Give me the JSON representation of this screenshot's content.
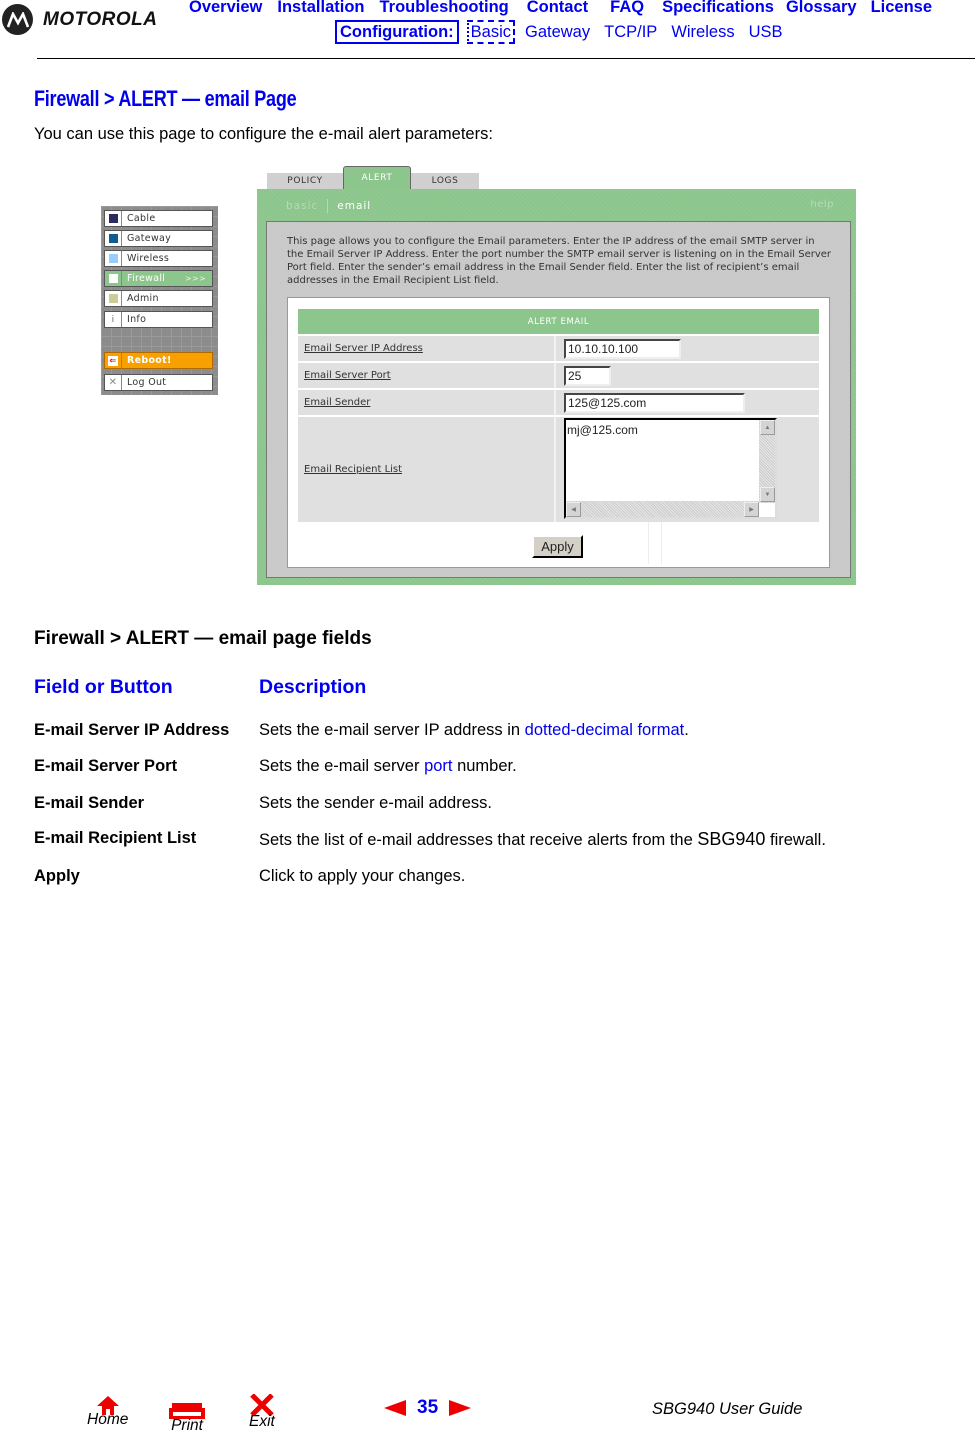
{
  "header": {
    "brand": "MOTOROLA",
    "nav_top": [
      "Overview",
      "Installation",
      "Troubleshooting",
      "Contact",
      "FAQ",
      "Specifications",
      "Glossary",
      "License"
    ],
    "config_label": "Configuration:",
    "nav_config": [
      "Basic",
      "Gateway",
      "TCP/IP",
      "Wireless",
      "USB"
    ]
  },
  "page": {
    "title": "Firewall > ALERT — email Page",
    "intro": "You can use this page to configure the e-mail alert parameters:"
  },
  "screenshot": {
    "sidebar": [
      {
        "label": "Cable",
        "icon": "square",
        "color": "#2b2b5e"
      },
      {
        "label": "Gateway",
        "icon": "square",
        "color": "#0e5f8c"
      },
      {
        "label": "Wireless",
        "icon": "square",
        "color": "#99ccff"
      },
      {
        "label": "Firewall",
        "icon": "square",
        "color": "#ffffff",
        "active": true,
        "arrow": ">>>"
      },
      {
        "label": "Admin",
        "icon": "square",
        "color": "#cccc99"
      },
      {
        "label": "Info",
        "icon": "i"
      },
      {
        "label": "Reboot!",
        "icon": "arrow-left"
      },
      {
        "label": "Log Out",
        "icon": "x"
      }
    ],
    "tabs": [
      "POLICY",
      "ALERT",
      "LOGS"
    ],
    "active_tab": "ALERT",
    "subnav": {
      "basic": "basic",
      "email": "email",
      "help": "help"
    },
    "description": "This page allows you to configure the Email parameters. Enter the IP address of the email SMTP server in the Email Server IP Address. Enter the port number the SMTP email server is listening on in the Email Server Port field. Enter the sender’s email address in the Email Sender field. Enter the list of recipient’s email addresses in the Email Recipient List field.",
    "form_header": "ALERT EMAIL",
    "fields": {
      "server_ip": {
        "label": "Email Server IP Address",
        "value": "10.10.10.100"
      },
      "server_port": {
        "label": "Email Server Port",
        "value": "25"
      },
      "sender": {
        "label": "Email Sender",
        "value": "125@125.com"
      },
      "recipients": {
        "label": "Email Recipient List",
        "value": "mj@125.com"
      }
    },
    "apply_label": "Apply",
    "accent_green": "#8cc68c",
    "reboot_orange": "#f7a000"
  },
  "fields_table": {
    "title": "Firewall > ALERT — email page fields",
    "col_field": "Field or Button",
    "col_desc": "Description",
    "rows": [
      {
        "field": "E-mail Server IP Address",
        "pre": "Sets the e-mail server IP address in ",
        "link": "dotted-decimal format",
        "post": "."
      },
      {
        "field": "E-mail Server Port",
        "pre": "Sets the e-mail server ",
        "link": "port",
        "post": " number."
      },
      {
        "field": "E-mail Sender",
        "pre": "Sets the sender e-mail address."
      },
      {
        "field": "E-mail Recipient List",
        "pre": "Sets the list of e-mail addresses that receive alerts from the ",
        "product": "SBG940",
        "post": " firewall."
      },
      {
        "field": "Apply",
        "pre": "Click to apply your changes."
      }
    ]
  },
  "footer": {
    "home": "Home",
    "print": "Print",
    "exit": "Exit",
    "page_number": "35",
    "guide": "SBG940 User Guide"
  }
}
